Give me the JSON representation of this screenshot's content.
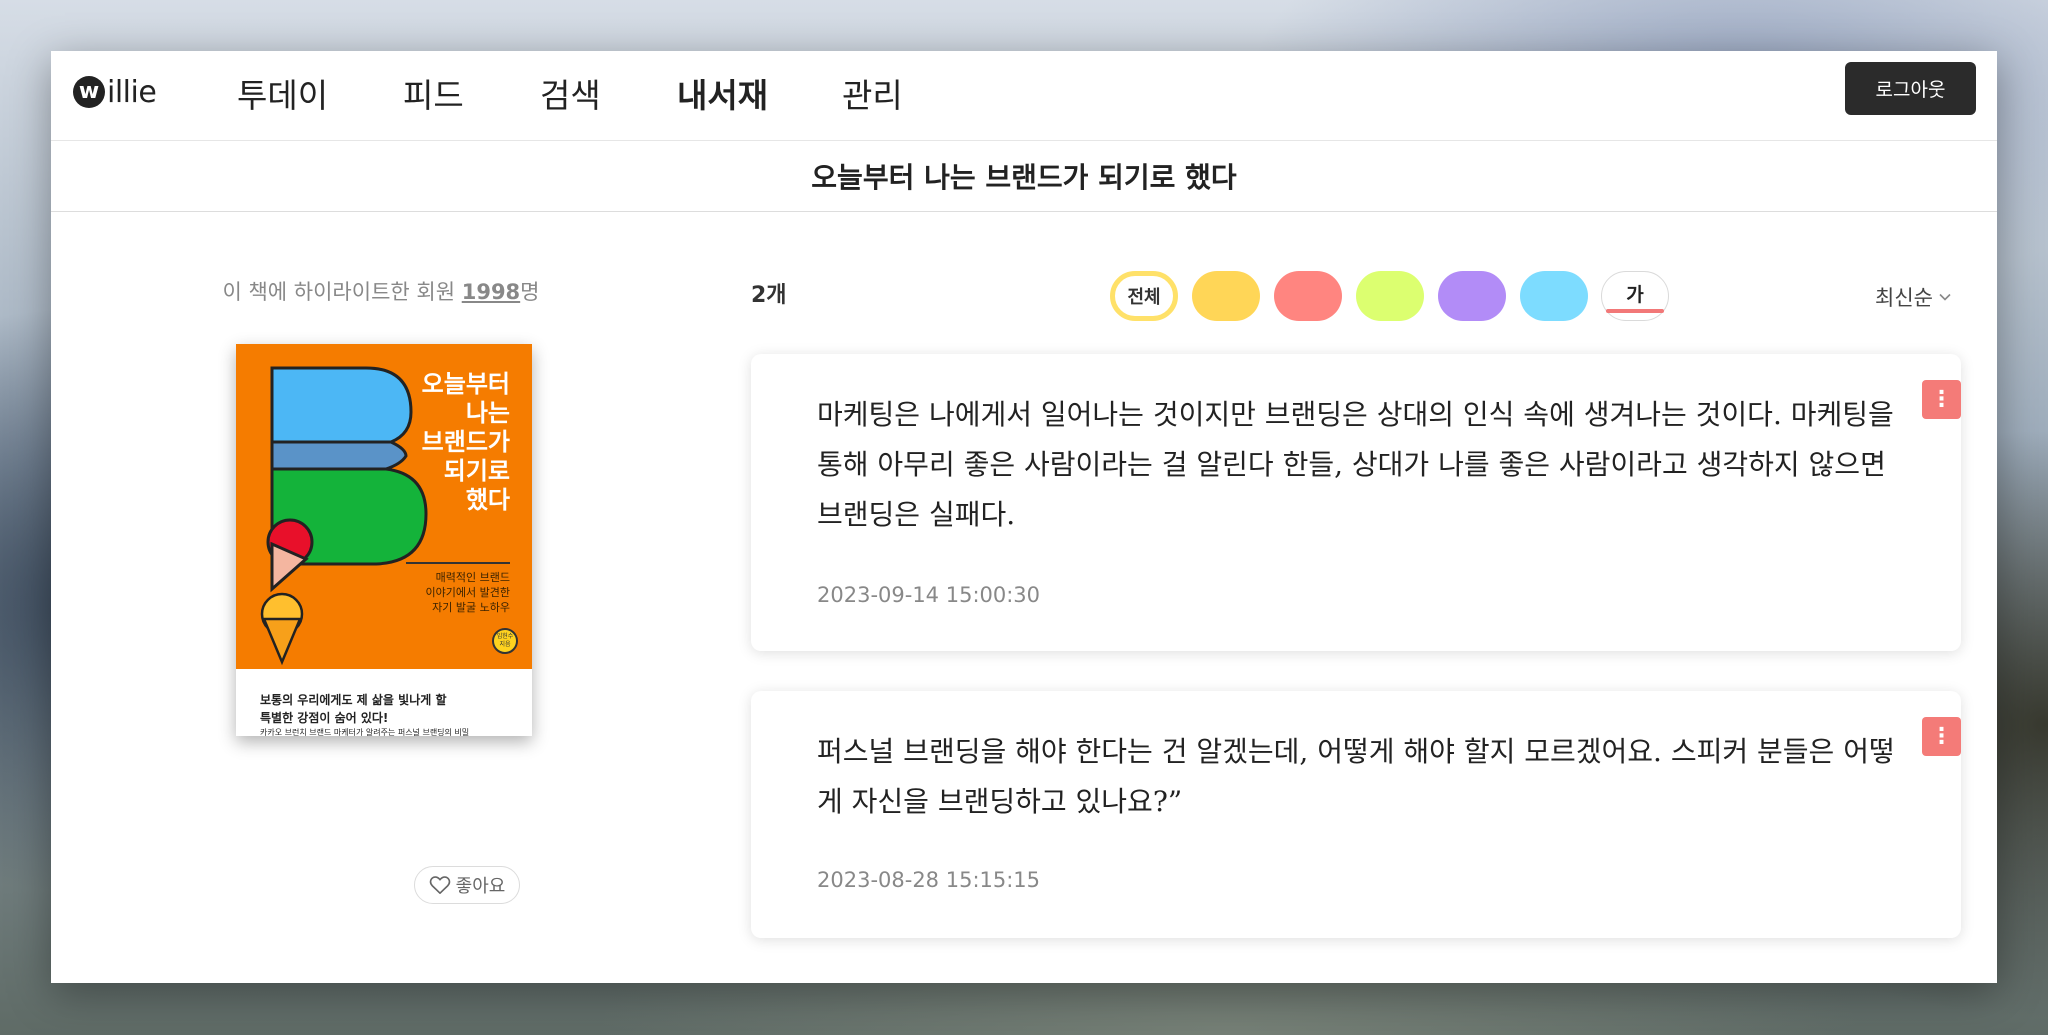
{
  "app": {
    "logo_text": "illie",
    "logo_mark": "w",
    "logout_label": "로그아웃"
  },
  "nav": {
    "items": [
      {
        "label": "투데이",
        "active": false
      },
      {
        "label": "피드",
        "active": false
      },
      {
        "label": "검색",
        "active": false
      },
      {
        "label": "내서재",
        "active": true
      },
      {
        "label": "관리",
        "active": false
      }
    ]
  },
  "book": {
    "title": "오늘부터 나는 브랜드가 되기로 했다",
    "highlight_prefix": "이 책에 하이라이트한 회원 ",
    "highlight_count": "1998",
    "highlight_suffix": "명",
    "cover": {
      "title": "오늘부터\n나는\n브랜드가\n되기로\n했다",
      "subtitle": "매력적인 브랜드\n이야기에서 발견한\n자기 발굴 노하우",
      "author_badge": "임헌수\n지음",
      "blurb_line1": "보통의 우리에게도 제 삶을 빛나게 할",
      "blurb_line2": "특별한 강점이 숨어 있다!",
      "blurb_line3": "카카오 브런치 브랜드 마케터가 알려주는 퍼스널 브랜딩의 비밀",
      "bg_color": "#f57c00"
    },
    "like_label": "좋아요"
  },
  "filters": {
    "count_label": "2개",
    "all_label": "전체",
    "colors": [
      "#ffd657",
      "#ff8580",
      "#dcff70",
      "#b28cf7",
      "#7ddcff"
    ],
    "text_filter_label": "가",
    "sort_label": "최신순"
  },
  "highlights": [
    {
      "text": "마케팅은 나에게서 일어나는 것이지만 브랜딩은 상대의 인식 속에 생겨나는 것이다. 마케팅을 통해 아무리 좋은 사람이라는 걸 알린다 한들, 상대가 나를 좋은 사람이라고 생각하지 않으면 브랜딩은 실패다.",
      "date": "2023-09-14 15:00:30"
    },
    {
      "text": "퍼스널 브랜딩을 해야 한다는 건 알겠는데, 어떻게 해야 할지 모르겠어요. 스피커 분들은 어떻게 자신을 브랜딩하고 있나요?”",
      "date": "2023-08-28 15:15:15"
    }
  ],
  "icons": {
    "menu": "more-vertical-icon",
    "heart": "heart-icon",
    "chevron": "chevron-down-icon"
  }
}
